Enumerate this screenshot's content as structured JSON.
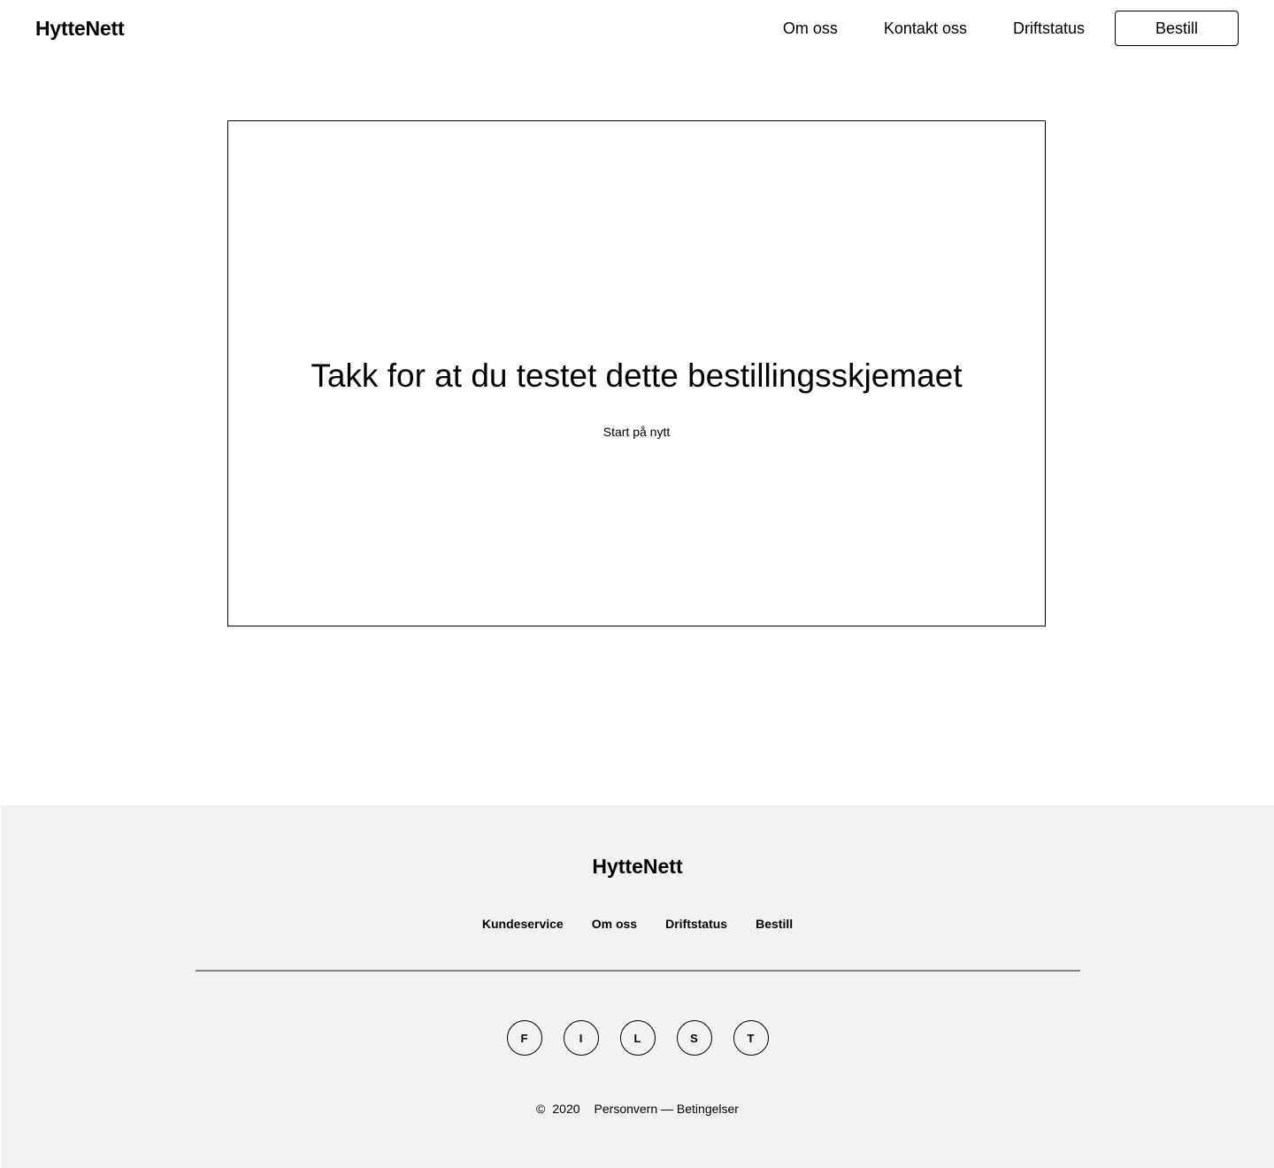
{
  "header": {
    "logo": "HytteNett",
    "nav": [
      {
        "label": "Om oss"
      },
      {
        "label": "Kontakt oss"
      },
      {
        "label": "Driftstatus"
      }
    ],
    "order_button": "Bestill"
  },
  "main": {
    "title": "Takk for at du testet dette bestillingsskjemaet",
    "restart_link": "Start på nytt"
  },
  "footer": {
    "logo": "HytteNett",
    "links": [
      {
        "label": "Kundeservice"
      },
      {
        "label": "Om oss"
      },
      {
        "label": "Driftstatus"
      },
      {
        "label": "Bestill"
      }
    ],
    "social": [
      {
        "letter": "F",
        "icon": "facebook-icon"
      },
      {
        "letter": "I",
        "icon": "instagram-icon"
      },
      {
        "letter": "L",
        "icon": "linkedin-icon"
      },
      {
        "letter": "S",
        "icon": "snapchat-icon"
      },
      {
        "letter": "T",
        "icon": "twitter-icon"
      }
    ],
    "copyright_symbol": "©",
    "year": "2020",
    "privacy": "Personvern",
    "dash": "—",
    "terms": "Betingelser",
    "background_color": "#f2f2f2",
    "divider_color": "#808080"
  }
}
